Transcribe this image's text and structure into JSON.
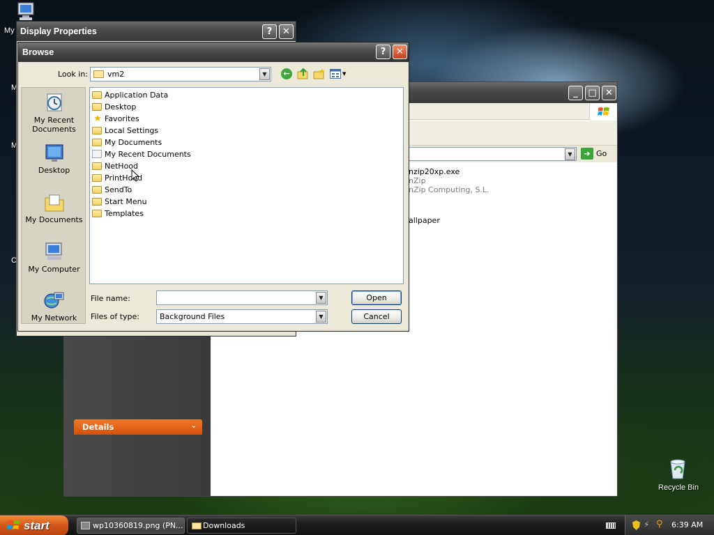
{
  "desktop": {
    "icon_labels": {
      "my_computer_partial": "My",
      "recycle_bin": "Recycle Bin"
    }
  },
  "explorer": {
    "address_go": "Go",
    "content": {
      "file1_name": "nzip20xp.exe",
      "file1_line2": "nZip",
      "file1_line3": "nZip Computing, S.L.",
      "file2_name": "allpaper"
    },
    "details_label": "Details"
  },
  "display_properties": {
    "title": "Display Properties"
  },
  "browse": {
    "title": "Browse",
    "look_in_label": "Look in:",
    "look_in_value": "vm2",
    "places": [
      {
        "label": "My Recent Documents",
        "icon": "recent-documents-icon"
      },
      {
        "label": "Desktop",
        "icon": "desktop-icon"
      },
      {
        "label": "My Documents",
        "icon": "my-documents-icon"
      },
      {
        "label": "My Computer",
        "icon": "my-computer-icon"
      },
      {
        "label": "My Network",
        "icon": "my-network-icon"
      }
    ],
    "folders": [
      {
        "name": "Application Data",
        "icon": "folder-icon"
      },
      {
        "name": "Desktop",
        "icon": "folder-icon"
      },
      {
        "name": "Favorites",
        "icon": "favorites-star-icon"
      },
      {
        "name": "Local Settings",
        "icon": "folder-icon"
      },
      {
        "name": "My Documents",
        "icon": "folder-icon"
      },
      {
        "name": "My Recent Documents",
        "icon": "recent-folder-icon"
      },
      {
        "name": "NetHood",
        "icon": "folder-icon"
      },
      {
        "name": "PrintHood",
        "icon": "folder-icon"
      },
      {
        "name": "SendTo",
        "icon": "folder-icon"
      },
      {
        "name": "Start Menu",
        "icon": "folder-icon"
      },
      {
        "name": "Templates",
        "icon": "folder-icon"
      }
    ],
    "file_name_label": "File name:",
    "file_name_value": "",
    "files_of_type_label": "Files of type:",
    "files_of_type_value": "Background Files",
    "open_label": "Open",
    "cancel_label": "Cancel"
  },
  "taskbar": {
    "start_label": "start",
    "items": [
      {
        "label": "wp10360819.png (PN..."
      },
      {
        "label": "Downloads"
      }
    ],
    "clock": "6:39 AM"
  }
}
